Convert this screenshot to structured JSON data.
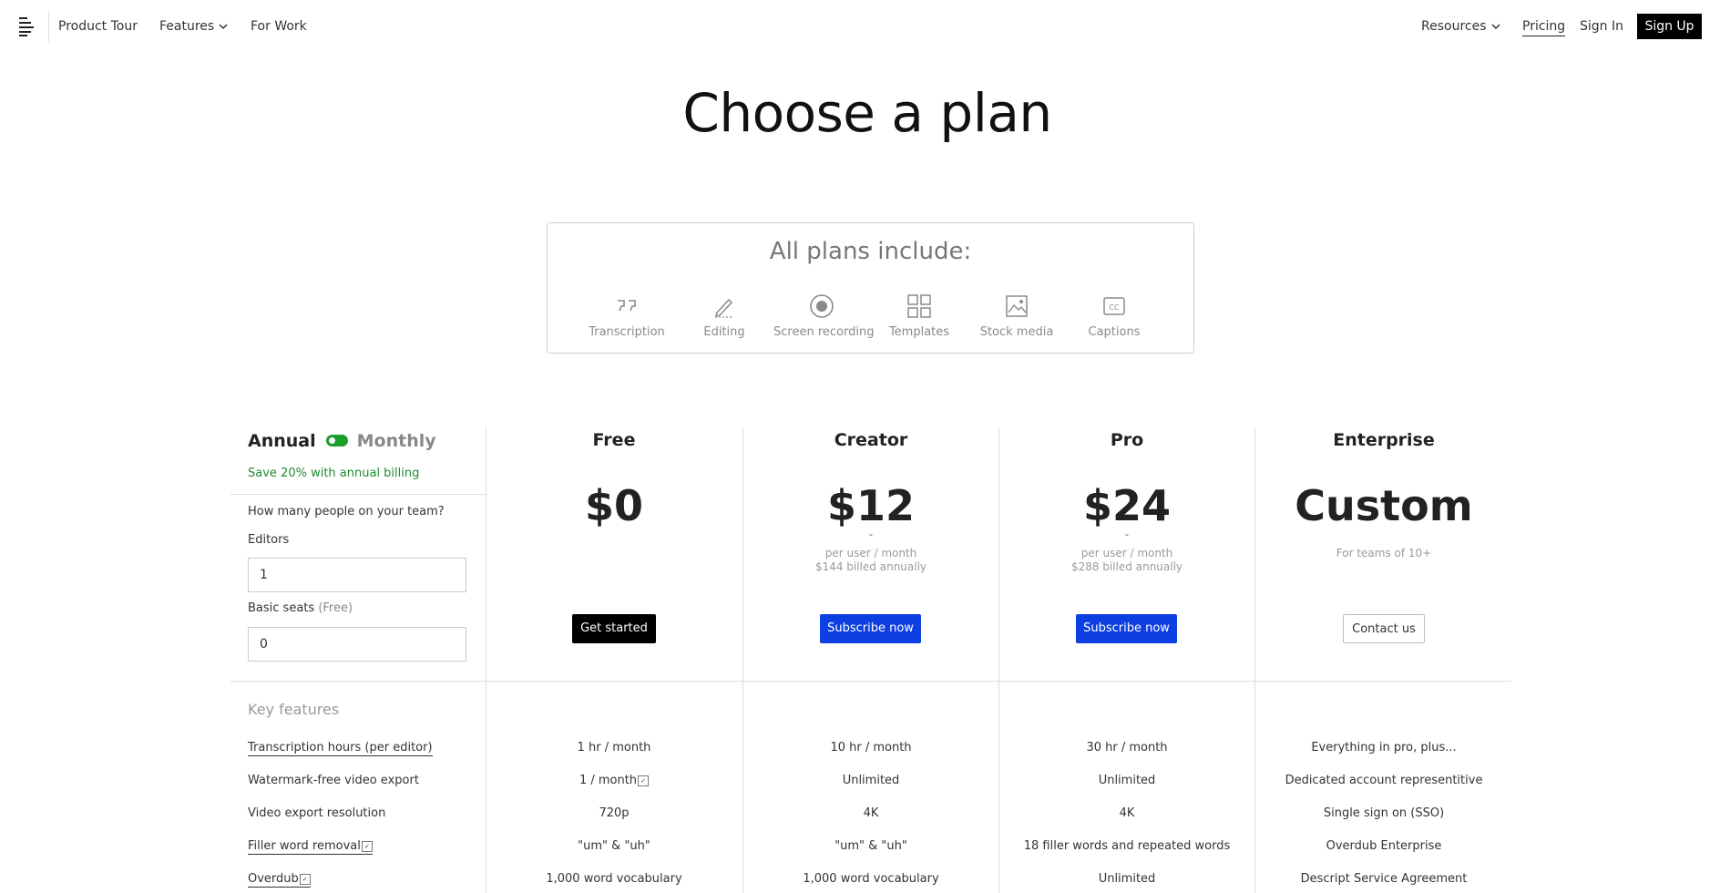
{
  "nav": {
    "left": [
      "Product Tour",
      "Features",
      "For Work"
    ],
    "right": [
      "Resources",
      "Pricing",
      "Sign In"
    ],
    "signup": "Sign Up"
  },
  "hero": {
    "title": "Choose a plan"
  },
  "includes": {
    "title": "All plans include:",
    "items": [
      {
        "label": "Transcription",
        "icon": "quote-icon"
      },
      {
        "label": "Editing",
        "icon": "pen-icon"
      },
      {
        "label": "Screen recording",
        "icon": "record-icon"
      },
      {
        "label": "Templates",
        "icon": "grid-icon"
      },
      {
        "label": "Stock media",
        "icon": "image-icon"
      },
      {
        "label": "Captions",
        "icon": "cc-icon"
      }
    ]
  },
  "billing": {
    "annual": "Annual",
    "monthly": "Monthly",
    "save_note": "Save 20% with annual billing",
    "toggle_color": "#1a9e2c"
  },
  "team": {
    "question": "How many people on your team?",
    "editors_label": "Editors",
    "editors_value": "1",
    "basic_label": "Basic seats",
    "basic_hint": "(Free)",
    "basic_value": "0"
  },
  "plans": [
    {
      "name": "Free",
      "price": "$0",
      "dash": "",
      "sub1": "",
      "sub2": "",
      "cta": "Get started"
    },
    {
      "name": "Creator",
      "price": "$12",
      "dash": "-",
      "sub1": "per user / month",
      "sub2": "$144 billed annually",
      "cta": "Subscribe now"
    },
    {
      "name": "Pro",
      "price": "$24",
      "dash": "-",
      "sub1": "per user / month",
      "sub2": "$288 billed annually",
      "cta": "Subscribe now"
    },
    {
      "name": "Enterprise",
      "price": "Custom",
      "dash": "",
      "sub1": "For teams of 10+",
      "sub2": "",
      "cta": "Contact us"
    }
  ],
  "colors": {
    "subscribe_button": "#0d3fe3",
    "cta_black": "#000000",
    "save_green": "#1e8c2e"
  },
  "features": {
    "title": "Key features",
    "rows": [
      {
        "label": "Transcription hours (per editor)",
        "values": [
          "1 hr / month",
          "10 hr / month",
          "30 hr / month",
          "Everything in pro, plus..."
        ]
      },
      {
        "label": "Watermark-free video export",
        "values": [
          "1 / month",
          "Unlimited",
          "Unlimited",
          "Dedicated account representitive"
        ]
      },
      {
        "label": "Video export resolution",
        "values": [
          "720p",
          "4K",
          "4K",
          "Single sign on (SSO)"
        ]
      },
      {
        "label": "Filler word removal",
        "values": [
          "\"um\" & \"uh\"",
          "\"um\" & \"uh\"",
          "18 filler words and repeated words",
          "Overdub Enterprise"
        ]
      },
      {
        "label": "Overdub",
        "values": [
          "1,000 word vocabulary",
          "1,000 word vocabulary",
          "Unlimited",
          "Descript Service Agreement"
        ]
      }
    ]
  }
}
